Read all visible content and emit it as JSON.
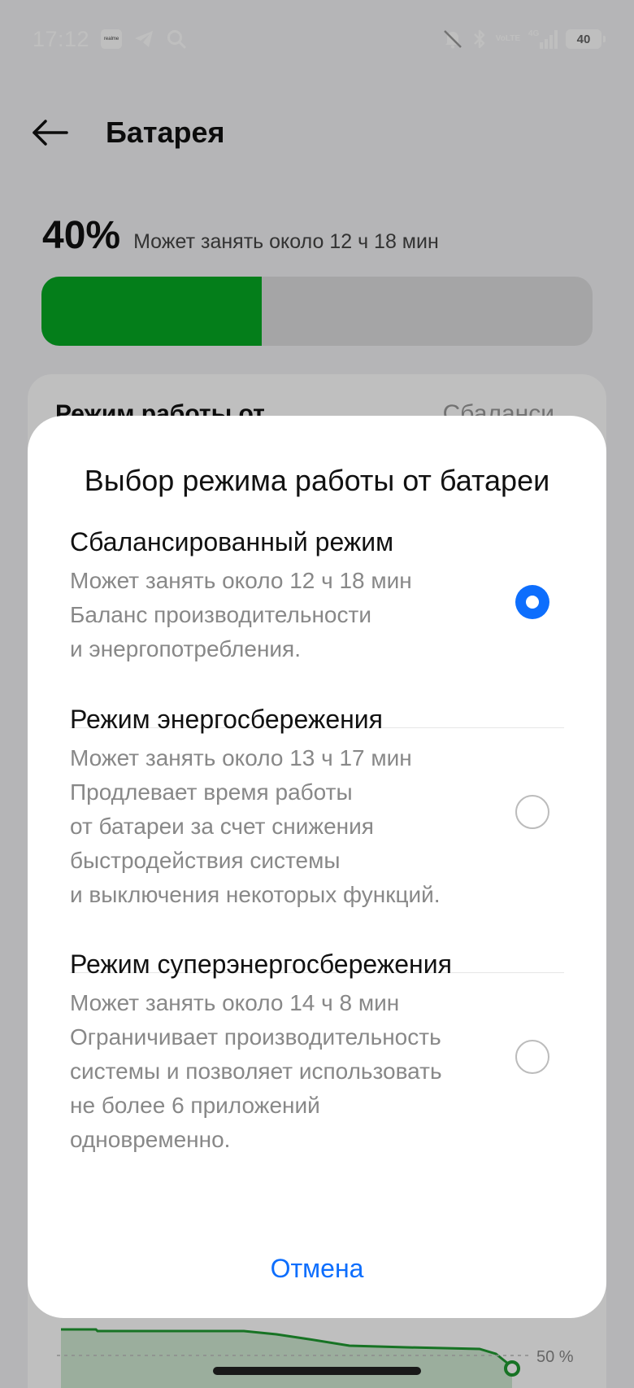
{
  "status_bar": {
    "time": "17:12",
    "notification_app": "realme",
    "icons": [
      "telegram-icon",
      "search-icon",
      "bell-off-icon",
      "bluetooth-icon",
      "volte-icon",
      "signal-icon"
    ],
    "volte_label_1": "Vo",
    "volte_label_2": "LTE",
    "network_label": "4G",
    "battery_level": "40"
  },
  "header": {
    "title": "Батарея"
  },
  "battery": {
    "percent_text": "40%",
    "estimate": "Может занять около 12 ч 18 мин",
    "level_fraction": 0.4,
    "fill_color": "#06a823"
  },
  "background_card": {
    "row_label": "Режим работы от",
    "row_value": "Сбаланси…"
  },
  "chart": {
    "reference_label": "50 %"
  },
  "dialog": {
    "title": "Выбор режима работы от батареи",
    "options": [
      {
        "name": "Сбалансированный режим",
        "description": "Может занять около 12 ч 18 мин\nБаланс производительности\nи энергопотребления.",
        "selected": true
      },
      {
        "name": "Режим энергосбережения",
        "description": "Может занять около 13 ч 17 мин\nПродлевает время работы\nот батареи за счет снижения\nбыстродействия системы\nи выключения некоторых функций.",
        "selected": false
      },
      {
        "name": "Режим суперэнергосбережения",
        "description": "Может занять около 14 ч 8 мин\nОграничивает производительность\nсистемы и позволяет использовать\nне более 6 приложений\nодновременно.",
        "selected": false
      }
    ],
    "cancel_label": "Отмена",
    "accent_color": "#0d6efd"
  }
}
